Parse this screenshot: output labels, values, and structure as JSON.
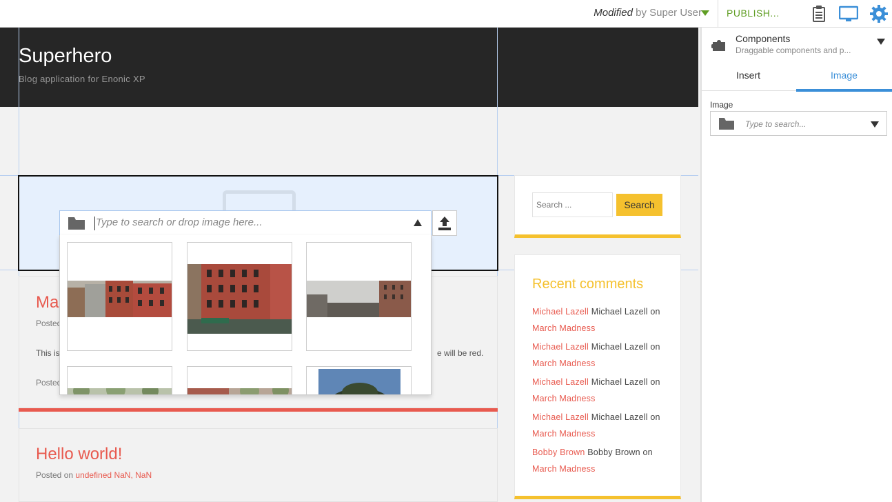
{
  "toolbar": {
    "modified_label": "Modified",
    "modified_by": "by Super User",
    "publish_label": "PUBLISH...",
    "icons": [
      "clipboard-icon",
      "monitor-icon",
      "gear-icon"
    ],
    "accent": "#609e24",
    "icon_blue": "#3b8fd8"
  },
  "site": {
    "title": "Superhero",
    "subtitle": "Blog application for Enonic XP"
  },
  "image_selector": {
    "placeholder": "Type to search or drop image here...",
    "icons": [
      "folder-icon",
      "collapse-arrow-icon",
      "upload-icon"
    ],
    "thumbnails": [
      "street-fire-escapes",
      "red-brick-building",
      "foggy-street",
      "trees-street",
      "building-trees",
      "sky-tree"
    ]
  },
  "posts": [
    {
      "title": "Mar",
      "meta_prefix": "Posted",
      "text_start": "This is",
      "text_end": "e will be red.",
      "footer": "Posted"
    },
    {
      "title": "Hello world!",
      "meta_prefix": "Posted on",
      "meta_link": "undefined NaN, NaN"
    }
  ],
  "sidebar": {
    "search": {
      "placeholder": "Search ...",
      "button": "Search"
    },
    "recent_comments": {
      "title": "Recent comments",
      "items": [
        {
          "author": "Michael Lazell",
          "name": "Michael Lazell",
          "on": "on",
          "post": "March Madness"
        },
        {
          "author": "Michael Lazell",
          "name": "Michael Lazell",
          "on": "on",
          "post": "March Madness"
        },
        {
          "author": "Michael Lazell",
          "name": "Michael Lazell",
          "on": "on",
          "post": "March Madness"
        },
        {
          "author": "Michael Lazell",
          "name": "Michael Lazell",
          "on": "on",
          "post": "March Madness"
        },
        {
          "author": "Bobby Brown",
          "name": "Bobby Brown",
          "on": "on",
          "post": "March Madness"
        }
      ]
    },
    "accent": "#f5c12e",
    "link_color": "#e85a4f"
  },
  "panel": {
    "title": "Components",
    "subtitle": "Draggable components and p...",
    "tabs": [
      "Insert",
      "Image"
    ],
    "active_tab": "Image",
    "field_label": "Image",
    "field_placeholder": "Type to search..."
  }
}
